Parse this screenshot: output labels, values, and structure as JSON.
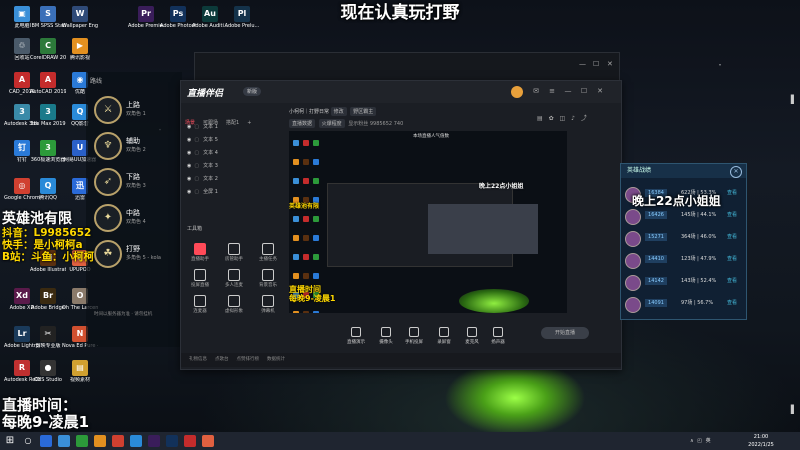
{
  "overlay_top": "现在认真玩打野",
  "desktop_icons": [
    {
      "label": "此电脑",
      "color": "#3a8fd8",
      "glyph": "▣"
    },
    {
      "label": "IBM SPSS Statistics 21",
      "color": "#3a6fb8",
      "glyph": "S"
    },
    {
      "label": "Wallpaper Engine:...",
      "color": "#2f4a78",
      "glyph": "W"
    },
    {
      "label": "Adobe Premie...",
      "color": "#3a1d5a",
      "glyph": "Pr"
    },
    {
      "label": "Adobe Photosh...",
      "color": "#12315a",
      "glyph": "Ps"
    },
    {
      "label": "Adobe Auditi...",
      "color": "#0c3a3a",
      "glyph": "Au"
    },
    {
      "label": "Adobe Prelu...",
      "color": "#14324a",
      "glyph": "Pl"
    },
    {
      "label": "回收站",
      "color": "#4a5a6a",
      "glyph": "♲"
    },
    {
      "label": "CorelDRAW 2020 (64-...",
      "color": "#2c7a3a",
      "glyph": "C"
    },
    {
      "label": "腾讯影视",
      "color": "#e39020",
      "glyph": "▶"
    },
    {
      "label": "CAD_2019",
      "color": "#c42c2c",
      "glyph": "A"
    },
    {
      "label": "AutoCAD 2019 - 简...",
      "color": "#c42c2c",
      "glyph": "A"
    },
    {
      "label": "优酷",
      "color": "#2a7ad8",
      "glyph": "◉"
    },
    {
      "label": "Autodesk 3ds 面出程序",
      "color": "#3a8aa8",
      "glyph": "3"
    },
    {
      "label": "3ds Max 2019",
      "color": "#1a7a8a",
      "glyph": "3"
    },
    {
      "label": "QQ影音",
      "color": "#2a8ad8",
      "glyph": "Q"
    },
    {
      "label": "钉钉",
      "color": "#2a7ad8",
      "glyph": "钉"
    },
    {
      "label": "360极速浏览器",
      "color": "#2c9a3a",
      "glyph": "3"
    },
    {
      "label": "网易UU加速器",
      "color": "#2a60c8",
      "glyph": "U"
    },
    {
      "label": "Google Chrome",
      "color": "#d04030",
      "glyph": "◎"
    },
    {
      "label": "腾讯QQ",
      "color": "#2a8ad8",
      "glyph": "Q"
    },
    {
      "label": "迅雷",
      "color": "#2a6ad8",
      "glyph": "迅"
    },
    {
      "label": "Adobe Illustrat...",
      "color": "#5a3010",
      "glyph": "Ai"
    },
    {
      "label": "UPUPOO",
      "color": "#e06040",
      "glyph": "U"
    },
    {
      "label": "Adobe XD",
      "color": "#5a1a4a",
      "glyph": "Xd"
    },
    {
      "label": "Adobe Bridge",
      "color": "#3a2a10",
      "glyph": "Br"
    },
    {
      "label": "Oh The Larceny",
      "color": "#8a7a6a",
      "glyph": "O"
    },
    {
      "label": "Adobe Lightroo...",
      "color": "#1a3a5a",
      "glyph": "Lr"
    },
    {
      "label": "剪映专业版",
      "color": "#222",
      "glyph": "✂"
    },
    {
      "label": "Nova Ed Pure - La...",
      "color": "#d05030",
      "glyph": "N"
    },
    {
      "label": "Autodesk ReCap",
      "color": "#c03030",
      "glyph": "R"
    },
    {
      "label": "OBS Studio",
      "color": "#333",
      "glyph": "●"
    },
    {
      "label": "视频素材",
      "color": "#d0a030",
      "glyph": "▤"
    }
  ],
  "yellow_overlay": {
    "title": "英雄池有限",
    "line1": "抖音：L9985652",
    "line2": "快手：是小柯柯a",
    "line3": "B站：斗鱼：小柯柯"
  },
  "bottom_left_overlay": {
    "line1": "直播时间：",
    "line2": "每晚9-凌晨1"
  },
  "left_panel": {
    "title": "路线",
    "roles": [
      {
        "name": "上路",
        "sub": "双角色 1",
        "glyph": "⚔"
      },
      {
        "name": "辅助",
        "sub": "双角色 2",
        "glyph": "♆"
      },
      {
        "name": "下路",
        "sub": "双角色 3",
        "glyph": "➶"
      },
      {
        "name": "中路",
        "sub": "双角色 4",
        "glyph": "✦"
      },
      {
        "name": "打野",
        "sub": "多角色 5 - kola",
        "glyph": "☘"
      }
    ],
    "desc": "时间以服务器为准 · 请勿挂机"
  },
  "app": {
    "logo": "直播伴侣",
    "version": "新版",
    "tabs": [
      "场景",
      "可跟场",
      "搭配1",
      "+"
    ],
    "scenes": [
      "文本 1",
      "文本 5",
      "文本 4",
      "文本 3",
      "文本 2",
      "全屏 1"
    ],
    "tools_title": "工具箱",
    "tools": [
      {
        "label": "直播助手",
        "red": true
      },
      {
        "label": "房管助手",
        "red": false
      },
      {
        "label": "主播任务",
        "red": false
      },
      {
        "label": "投屏直播",
        "red": false
      },
      {
        "label": "多人连麦",
        "red": false
      },
      {
        "label": "背景音乐",
        "red": false
      },
      {
        "label": "连麦器",
        "red": false
      },
      {
        "label": "虚拟形象",
        "red": false
      },
      {
        "label": "弹幕机",
        "red": false
      }
    ],
    "stream_title": "小柯柯｜打野日常",
    "stream_tags": [
      "修改",
      "野区霸主"
    ],
    "stream_meta": [
      "直播数据",
      "火爆程度",
      "显示粉丝",
      "9985652",
      "740"
    ],
    "preview_label": "本场直播人气值数",
    "preview_overlay_left": "英雄池有限",
    "preview_overlay_right": "晚上22点小姐姐",
    "preview_yellow_1": "直播时间",
    "preview_yellow_2": "每晚9-凌晨1",
    "bottom_tools": [
      "直播演示",
      "摄像头",
      "手机投屏",
      "录屏窗",
      "麦克风",
      "扬声器"
    ],
    "start_button": "开始直播",
    "status": [
      "礼物信息",
      "点歌台",
      "点赞排行榜",
      "数据统计"
    ]
  },
  "right_panel": {
    "title": "英雄战绩",
    "overlay": "晚上22点小姐姐",
    "rows": [
      {
        "score": "16384",
        "stat": "622场 | 53.3%",
        "link": "查看"
      },
      {
        "score": "16426",
        "stat": "145场 | 44.1%",
        "link": "查看"
      },
      {
        "score": "15271",
        "stat": "364场 | 46.0%",
        "link": "查看"
      },
      {
        "score": "14410",
        "stat": "123场 | 47.9%",
        "link": "查看"
      },
      {
        "score": "14142",
        "stat": "143场 | 52.4%",
        "link": "查看"
      },
      {
        "score": "14091",
        "stat": "97场 | 56.7%",
        "link": "查看"
      }
    ]
  },
  "taskbar": {
    "time": "21:00",
    "date": "2022/1/25",
    "tray": "∧ ◰ 英"
  }
}
